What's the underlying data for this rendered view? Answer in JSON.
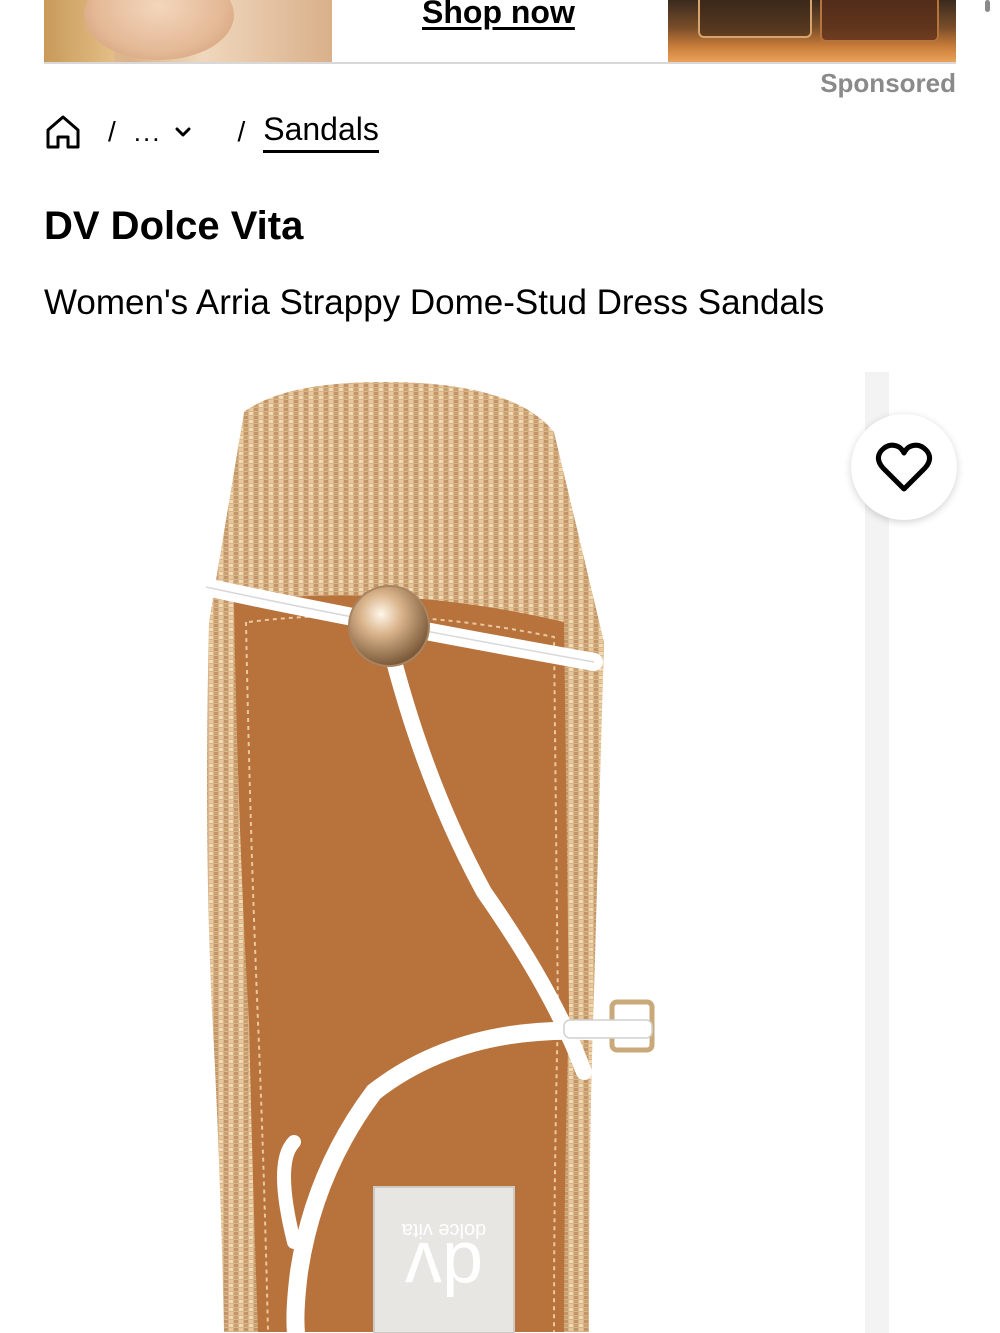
{
  "ad": {
    "cta_label": "Shop now",
    "sponsored_label": "Sponsored"
  },
  "breadcrumb": {
    "home_icon": "home-icon",
    "separator": "/",
    "more_label": "...",
    "more_icon": "chevron-down-icon",
    "current": "Sandals"
  },
  "product": {
    "brand": "DV Dolce Vita",
    "name": "Women's Arria Strappy Dome-Stud Dress Sandals",
    "image_logo_text": "dolce vita",
    "image_logo_mark": "dv",
    "wishlist_icon": "heart-outline-icon"
  },
  "colors": {
    "raffia": "#d9b487",
    "footbed": "#b8723b",
    "strap": "#ffffff",
    "stud": "#d9b38a"
  }
}
